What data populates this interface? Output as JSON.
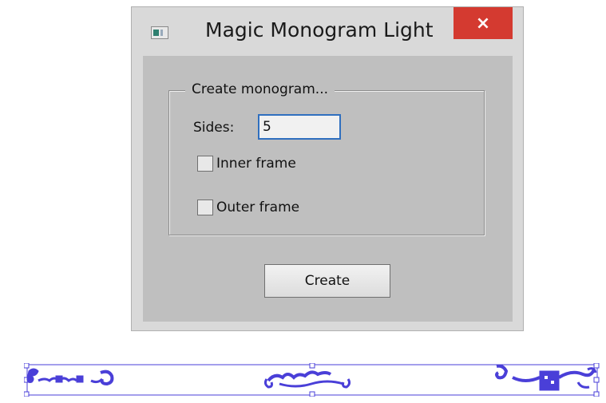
{
  "window": {
    "title": "Magic Monogram Light",
    "close_glyph": "×"
  },
  "group": {
    "legend": "Create monogram..."
  },
  "sides": {
    "label": "Sides:",
    "value": "5"
  },
  "options": {
    "inner_frame_label": "Inner frame",
    "inner_frame_checked": false,
    "outer_frame_label": "Outer frame",
    "outer_frame_checked": false
  },
  "buttons": {
    "create_label": "Create"
  },
  "preview": {
    "stroke_color": "#4a3fd8",
    "fill_color": "#4a3fd8"
  },
  "icons": {
    "app": "app-window-icon",
    "close": "close-icon"
  }
}
